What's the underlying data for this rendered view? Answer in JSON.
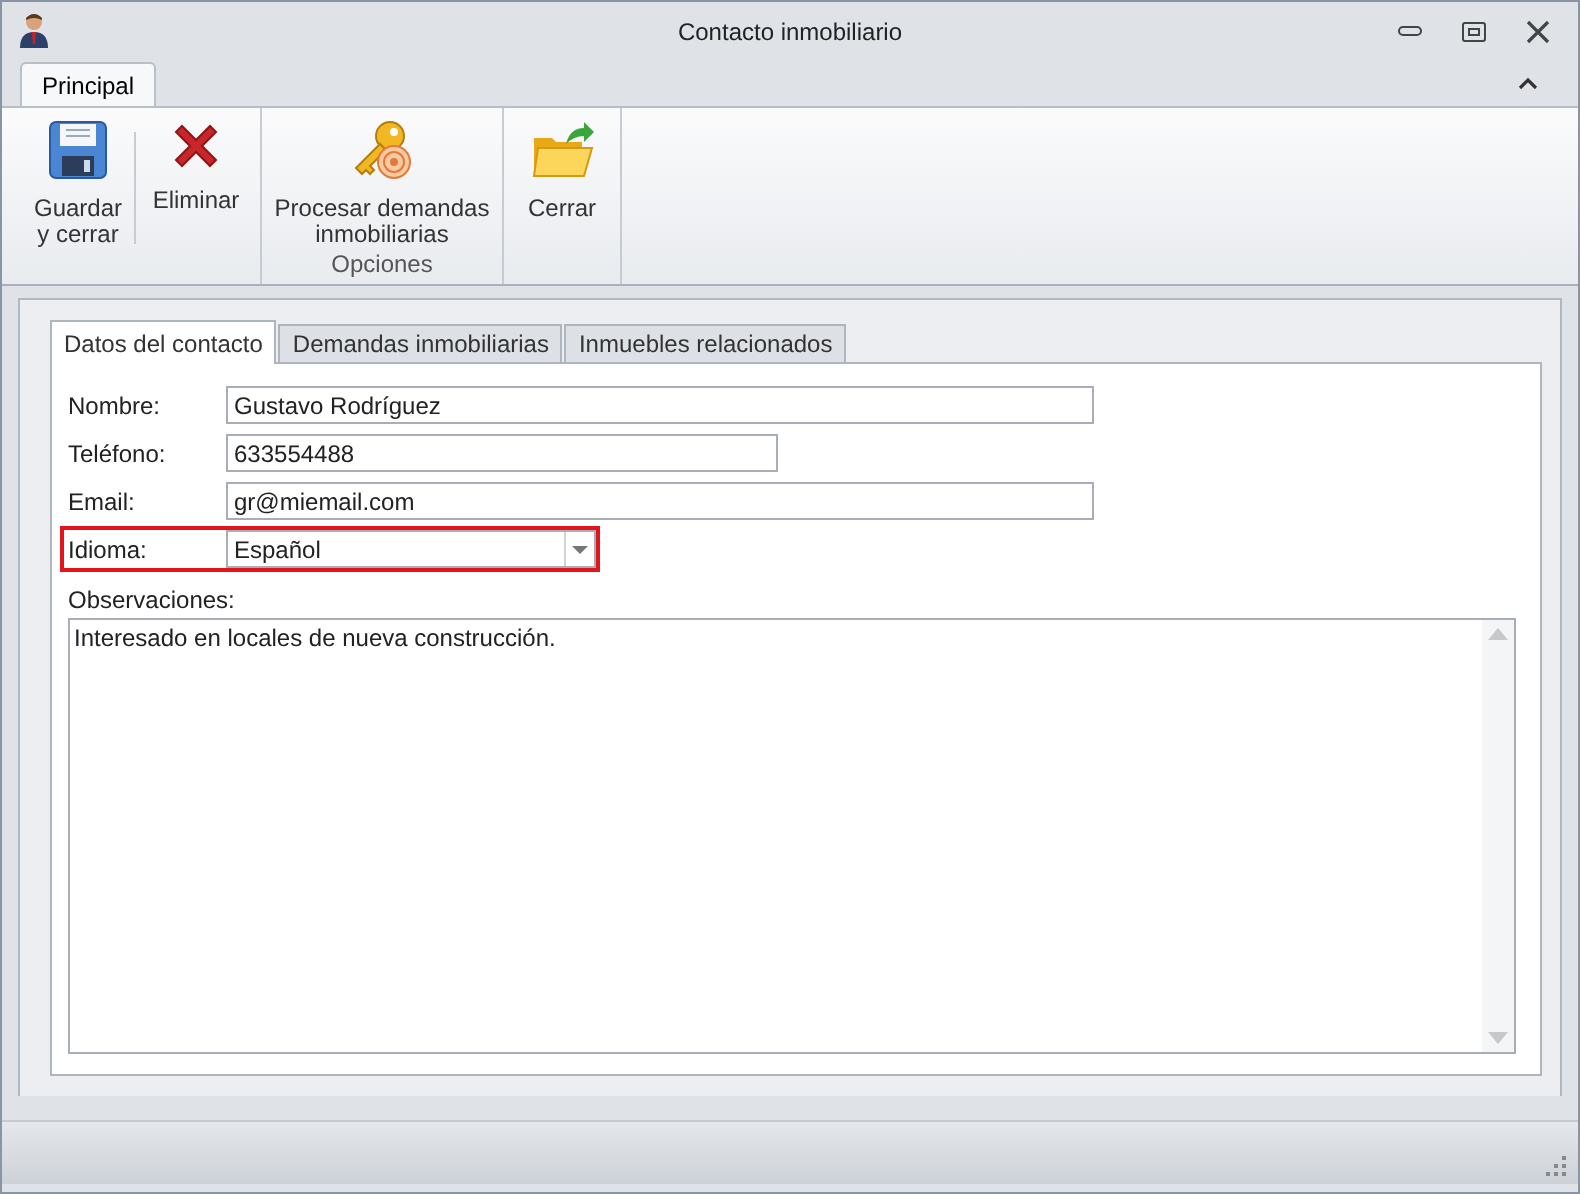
{
  "window": {
    "title": "Contacto inmobiliario"
  },
  "ribbon": {
    "tabs": [
      {
        "label": "Principal",
        "selected": true
      }
    ],
    "groups": [
      {
        "buttons": [
          {
            "kind": "save",
            "label": "Guardar y cerrar"
          },
          {
            "kind": "delete",
            "label": "Eliminar"
          }
        ]
      },
      {
        "label": "Opciones",
        "buttons": [
          {
            "kind": "process",
            "label": "Procesar demandas inmobiliarias"
          }
        ]
      },
      {
        "buttons": [
          {
            "kind": "close",
            "label": "Cerrar"
          }
        ]
      }
    ]
  },
  "tabs": [
    {
      "label": "Datos del contacto",
      "selected": true
    },
    {
      "label": "Demandas inmobiliarias",
      "selected": false
    },
    {
      "label": "Inmuebles relacionados",
      "selected": false
    }
  ],
  "fields": [
    {
      "kind": "text",
      "label": "Nombre:",
      "value": "Gustavo Rodríguez",
      "highlighted": false
    },
    {
      "kind": "text",
      "label": "Teléfono:",
      "value": "633554488",
      "highlighted": false
    },
    {
      "kind": "text",
      "label": "Email:",
      "value": "gr@miemail.com",
      "highlighted": false
    },
    {
      "kind": "combo",
      "label": "Idioma:",
      "value": "Español",
      "highlighted": true
    }
  ],
  "notes": {
    "label": "Observaciones:",
    "value": "Interesado en locales de nueva construcción."
  }
}
